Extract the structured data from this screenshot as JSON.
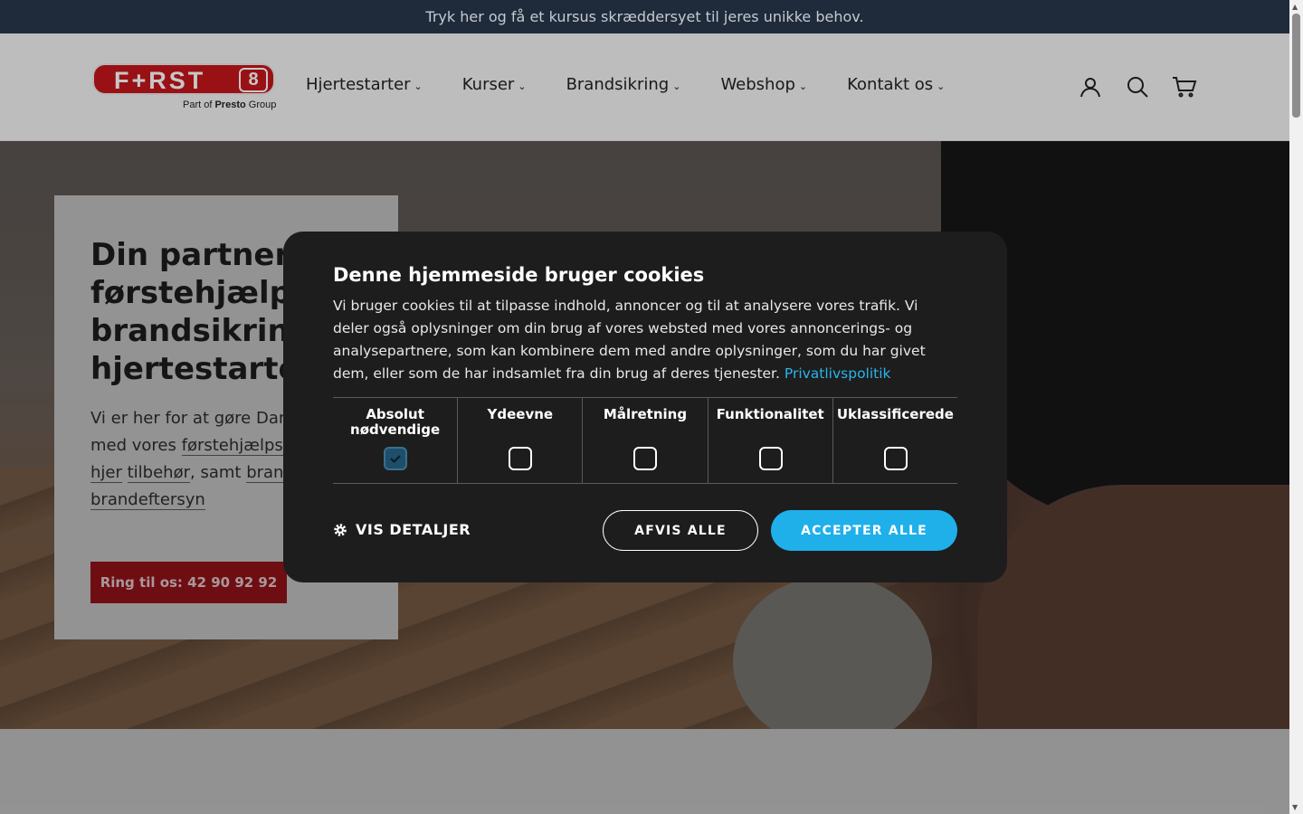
{
  "announcement": "Tryk her og få et kursus skræddersyet til jeres unikke behov.",
  "logo": {
    "text": "F+RST",
    "number": "8",
    "tagline_prefix": "Part of",
    "tagline_brand": "Presto",
    "tagline_suffix": "Group"
  },
  "nav": [
    {
      "label": "Hjertestarter"
    },
    {
      "label": "Kurser"
    },
    {
      "label": "Brandsikring"
    },
    {
      "label": "Webshop"
    },
    {
      "label": "Kontakt os"
    }
  ],
  "hero": {
    "title": "Din partner i\nførstehjælp,\nbrandsikring\nhjertestarte",
    "text_intro": "Vi er her for at gøre Dan sikrere med vores ",
    "link1": "førstehjælpskursus",
    "text_mid": ", ",
    "link2": "hjer",
    "text_mid2": " ",
    "link3": "tilbehør",
    "text_mid3": ", samt ",
    "link4": "brandproc",
    "text_mid4": " ",
    "link5": "brandeftersyn",
    "cta": "Ring til os: 42 90 92 92"
  },
  "cookie": {
    "title": "Denne hjemmeside bruger cookies",
    "body": "Vi bruger cookies til at tilpasse indhold, annoncer og til at analysere vores trafik. Vi deler også oplysninger om din brug af vores websted med vores annoncerings- og analysepartnere, som kan kombinere dem med andre oplysninger, som du har givet dem, eller som de har indsamlet fra din brug af deres tjenester.",
    "privacy_link": "Privatlivspolitik",
    "categories": [
      {
        "label": "Absolut\nnødvendige",
        "checked": true
      },
      {
        "label": "Ydeevne",
        "checked": false
      },
      {
        "label": "Målretning",
        "checked": false
      },
      {
        "label": "Funktionalitet",
        "checked": false
      },
      {
        "label": "Uklassificerede",
        "checked": false
      }
    ],
    "details_label": "VIS DETALJER",
    "decline_label": "AFVIS ALLE",
    "accept_label": "ACCEPTER ALLE"
  },
  "colors": {
    "brand_red": "#c4161c",
    "accept_blue": "#1fb0ea",
    "dialog_bg": "#1d1d1d"
  }
}
